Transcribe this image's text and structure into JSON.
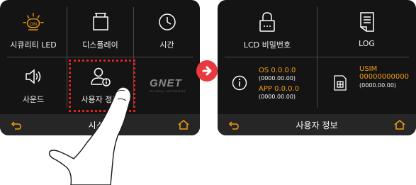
{
  "left_screen": {
    "tiles": [
      {
        "label": "시큐리티 LED",
        "icon": "security-led-icon",
        "on_text": "ON"
      },
      {
        "label": "디스플레이",
        "icon": "display-icon"
      },
      {
        "label": "시간",
        "icon": "clock-icon"
      },
      {
        "label": "사운드",
        "icon": "speaker-icon"
      },
      {
        "label": "사용자 정보",
        "icon": "user-info-icon"
      }
    ],
    "logo_text": "GNET",
    "logo_subtext": "GLOBAL NETWORK",
    "bottom_title": "시스템"
  },
  "right_screen": {
    "tiles": [
      {
        "label": "LCD 비밀번호",
        "icon": "lock-icon"
      },
      {
        "label": "LOG",
        "icon": "log-document-icon"
      }
    ],
    "os_label": "OS 0.0.0.0",
    "os_date": "(0000.00.00)",
    "app_label": "APP 0.0.0.0",
    "app_date": "(0000.00.00)",
    "usim_label": "USIM",
    "usim_number": "00000000000",
    "usim_date": "(0000.00.00)",
    "bottom_title": "사용자 정보"
  },
  "colors": {
    "accent": "#f39c12",
    "highlight": "#e02020",
    "arrow": "#e8393f",
    "screen_bg": "#141414"
  }
}
